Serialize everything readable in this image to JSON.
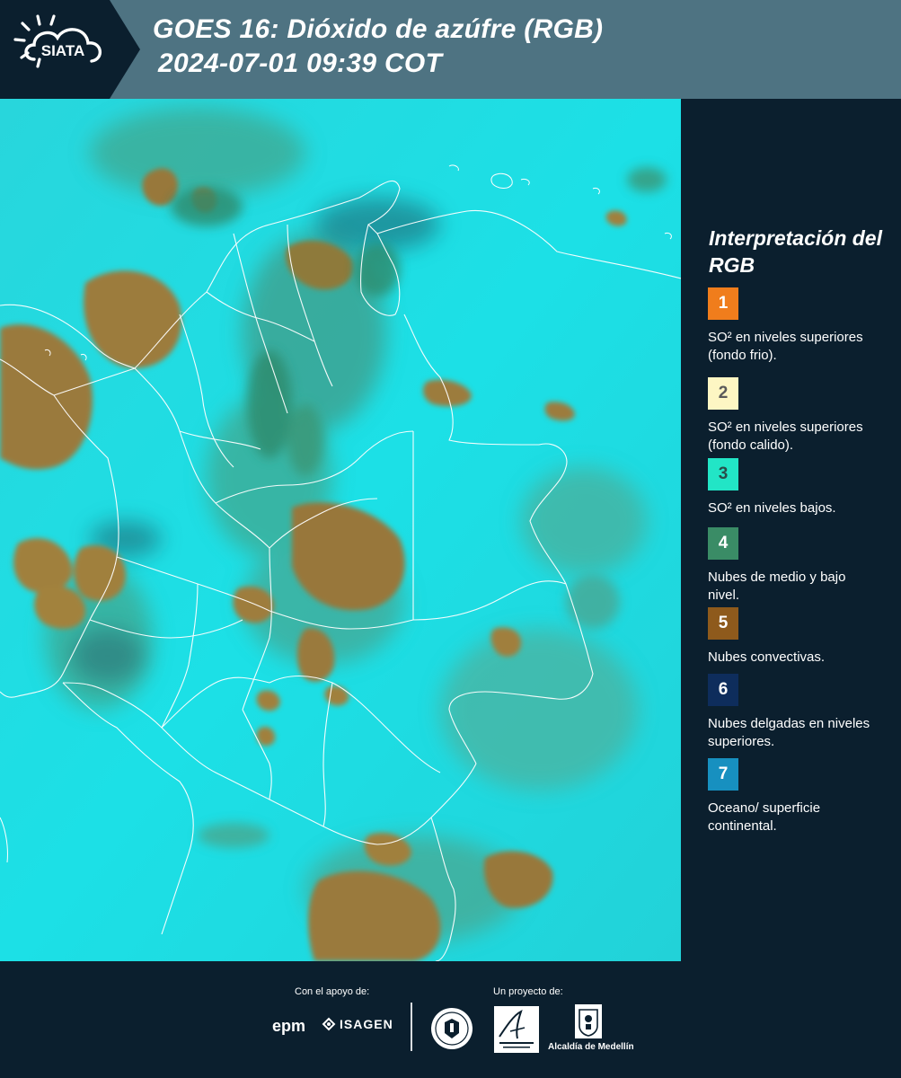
{
  "header": {
    "brand": "SIATA",
    "title_line1": "GOES 16: Dióxido de azúfre (RGB)",
    "title_line2": "2024-07-01 09:39 COT"
  },
  "legend": {
    "title": "Interpretación del RGB",
    "items": [
      {
        "number": "1",
        "label": "SO² en niveles superiores (fondo frio).",
        "color": "#f07d1c",
        "text_color": "#ffffff"
      },
      {
        "number": "2",
        "label": "SO² en niveles superiores (fondo calido).",
        "color": "#fdf6c3",
        "text_color": "#5a5a5a"
      },
      {
        "number": "3",
        "label": "SO² en niveles bajos.",
        "color": "#22e5c6",
        "text_color": "#2a4c4a"
      },
      {
        "number": "4",
        "label": "Nubes de medio y bajo nivel.",
        "color": "#3a8c66",
        "text_color": "#ffffff"
      },
      {
        "number": "5",
        "label": "Nubes convectivas.",
        "color": "#8e5a1c",
        "text_color": "#ffffff"
      },
      {
        "number": "6",
        "label": "Nubes delgadas en niveles superiores.",
        "color": "#0e2d5c",
        "text_color": "#ffffff"
      },
      {
        "number": "7",
        "label": "Oceano/ superficie continental.",
        "color": "#1790c0",
        "text_color": "#ffffff"
      }
    ]
  },
  "footer": {
    "support_caption": "Con el apoyo de:",
    "project_caption": "Un proyecto de:",
    "sponsors": [
      "epm",
      "ISAGEN"
    ],
    "partners": [
      "Área Metropolitana Valle de Aburrá",
      "Alcaldía de Medellín"
    ]
  },
  "colors": {
    "background": "#0b1f2e",
    "header_band": "#4e7382",
    "sea_surface": "#1ad8e0",
    "convective_cloud": "#9a7a3c",
    "mid_cloud": "#3fa890",
    "borders": "#ffffff"
  }
}
